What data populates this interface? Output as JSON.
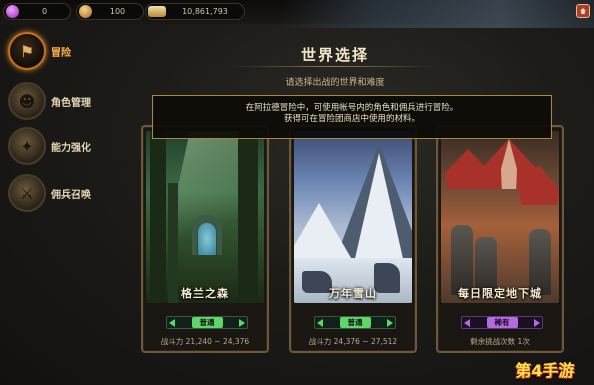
{
  "resources": {
    "gems": "0",
    "coins": "100",
    "gold": "10,861,793"
  },
  "sidebar": {
    "items": [
      {
        "label": "冒险",
        "icon": "adventure-icon",
        "active": true
      },
      {
        "label": "角色管理",
        "icon": "character-icon",
        "active": false
      },
      {
        "label": "能力强化",
        "icon": "power-up-icon",
        "active": false
      },
      {
        "label": "佣兵召唤",
        "icon": "recruit-icon",
        "active": false
      }
    ]
  },
  "main": {
    "title": "世界选择",
    "subtitle": "请选择出战的世界和难度"
  },
  "tooltip": {
    "line1": "在阿拉德冒险中，可使用帐号内的角色和佣兵进行冒险。",
    "line2": "获得可在冒险团商店中使用的材料。"
  },
  "cards": [
    {
      "name": "格兰之森",
      "difficulty": "普通",
      "rarity": "normal",
      "power_text": "战斗力 21,240 ~ 24,376"
    },
    {
      "name": "万年雪山",
      "difficulty": "普通",
      "rarity": "normal",
      "power_text": "战斗力 24,376 ~ 27,512"
    },
    {
      "name": "每日限定地下城",
      "difficulty": "稀有",
      "rarity": "rare",
      "power_text": "剩余挑战次数 1次"
    }
  ],
  "watermark": "第4手游",
  "colors": {
    "accent_orange": "#ffb04a",
    "normal_green": "#5fd66a",
    "rare_purple": "#b56ae0",
    "frame_gold": "#a88a3a"
  }
}
